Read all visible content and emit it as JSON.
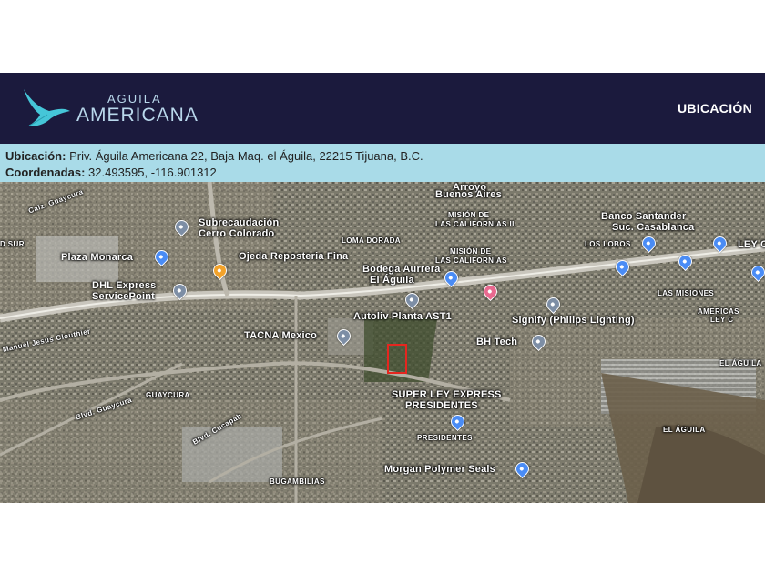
{
  "header": {
    "logo_line1": "AGUILA",
    "logo_line2": "AMERICANA",
    "nav_label": "UBICACIÓN"
  },
  "info": {
    "address_label": "Ubicación:",
    "address": "Priv. Águila Americana 22, Baja Maq. el Águila, 22215 Tijuana, B.C.",
    "coords_label": "Coordenadas:",
    "coords": "32.493595, -116.901312"
  },
  "map": {
    "labels": {
      "arroyo": "Arroyo",
      "buenos_aires": "Buenos Aires",
      "subrecaudacion": "Subrecaudación",
      "cerro_colorado": "Cerro Colorado",
      "banco1": "Banco Santander",
      "banco2": "Suc. Casablanca",
      "mision1": "MISIÓN DE",
      "mision2": "LAS CALIFORNIAS II",
      "loma_dorada": "LOMA DORADA",
      "los_lobos": "LOS LOBOS",
      "ley_c": "LEY C",
      "plaza_monarca": "Plaza Monarca",
      "ojeda": "Ojeda Reposteria Fina",
      "mision3": "MISIÓN DE",
      "mision4": "LAS CALIFORNIAS",
      "bodega1": "Bodega Aurrera",
      "bodega2": "El Águila",
      "dhl1": "DHL Express",
      "dhl2": "ServicePoint",
      "las_misiones": "LAS MISIONES",
      "autoliv": "Autoliv Planta AST1",
      "signify": "Signify (Philips Lighting)",
      "americas1": "AMERICAS",
      "americas2": "LEY C",
      "tacna": "TACNA Mexico",
      "bh_tech": "BH Tech",
      "clouthier": "Manuel Jesús Clouthier",
      "el_aguila1": "EL ÁGUILA",
      "guaycura": "GUAYCURA",
      "superley1": "SUPER LEY EXPRESS",
      "superley2": "PRESIDENTES",
      "presidentes": "PRESIDENTES",
      "el_aguila2": "EL ÁGUILA",
      "blvd_guaycura": "Blvd. Guaycura",
      "blvd_cucapah": "Blvd. Cucapah",
      "morgan": "Morgan Polymer Seals",
      "bugambilias": "BUGAMBILIAS",
      "gruta": "D SUR",
      "gato": "Calz. Guaycura"
    }
  }
}
